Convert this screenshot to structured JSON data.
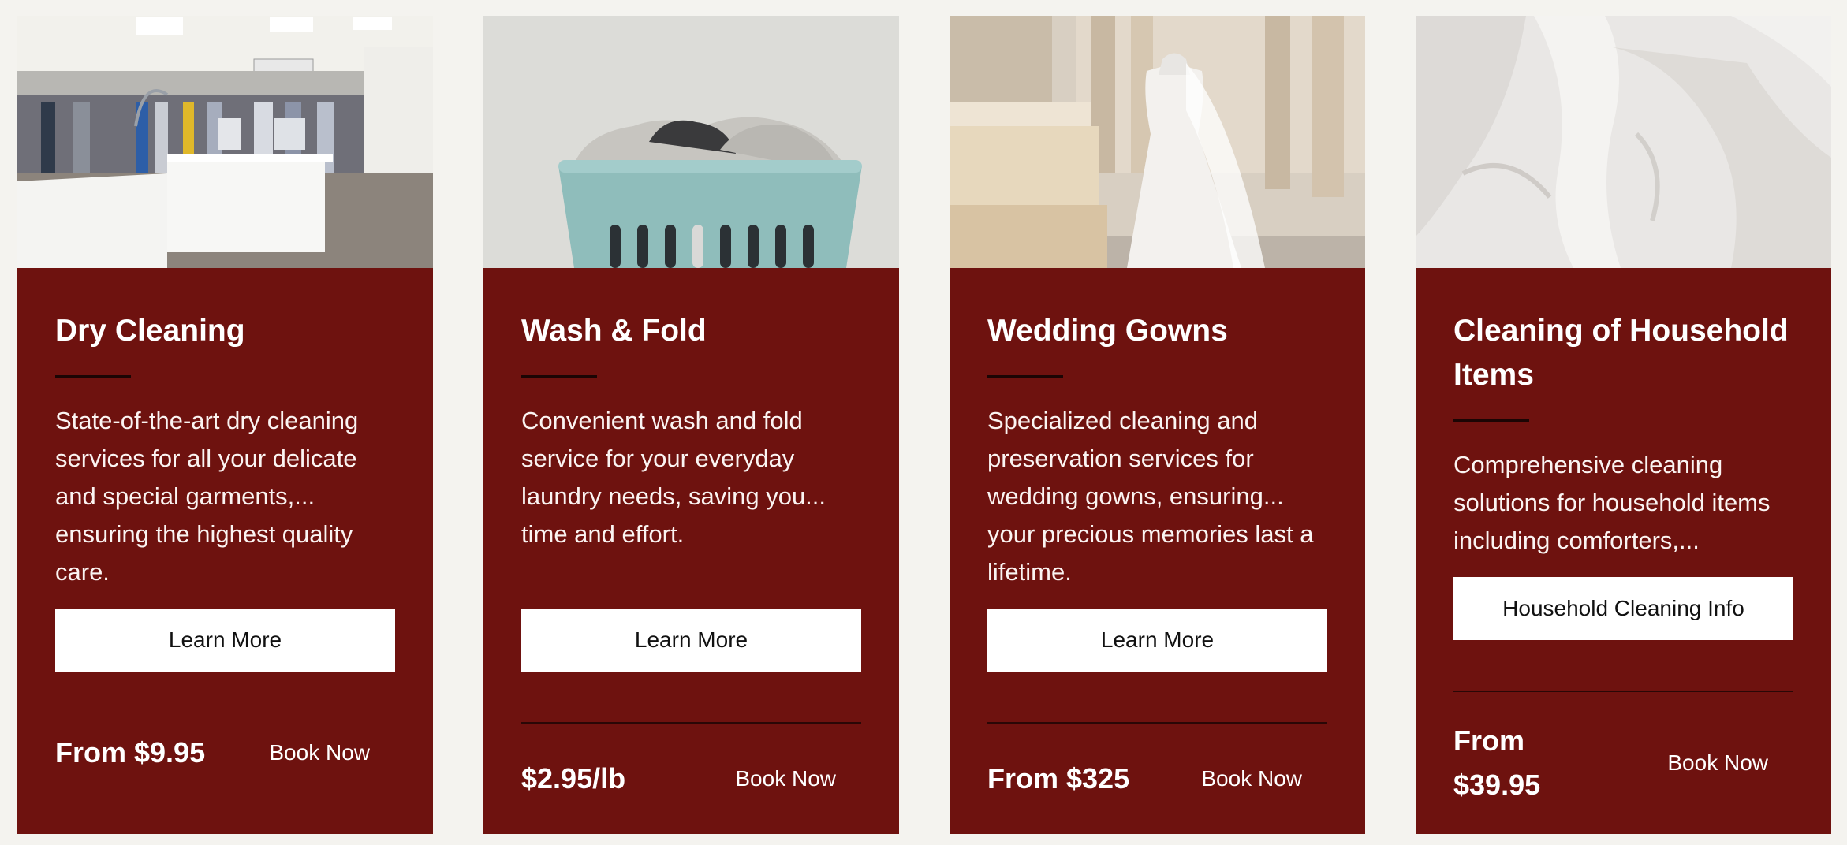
{
  "cards": [
    {
      "photo_subject": "dry-cleaning-store-interior",
      "title": "Dry Cleaning",
      "description": "State-of-the-art dry cleaning services for all your delicate and special garments,... ensuring the highest quality care.",
      "button_label": "Learn More",
      "price": "From $9.95",
      "book_label": "Book Now"
    },
    {
      "photo_subject": "laundry-basket",
      "title": "Wash & Fold",
      "description": "Convenient wash and fold service for your everyday laundry needs, saving you... time and effort.",
      "button_label": "Learn More",
      "price": "$2.95/lb",
      "book_label": "Book Now"
    },
    {
      "photo_subject": "wedding-gown-in-bedroom",
      "title": "Wedding Gowns",
      "description": "Specialized cleaning and preservation services for wedding gowns, ensuring... your precious memories last a lifetime.",
      "button_label": "Learn More",
      "price": "From $325",
      "book_label": "Book Now"
    },
    {
      "photo_subject": "white-bedding",
      "title": "Cleaning of Household Items",
      "description": "Comprehensive cleaning solutions for household items including comforters,...",
      "button_label": "Household Cleaning Info",
      "price": "From $39.95",
      "book_label": "Book Now"
    }
  ],
  "colors": {
    "page_background": "#f4f3ef",
    "card_background": "#6e120f",
    "button_background": "#ffffff",
    "text": "#ffffff"
  }
}
